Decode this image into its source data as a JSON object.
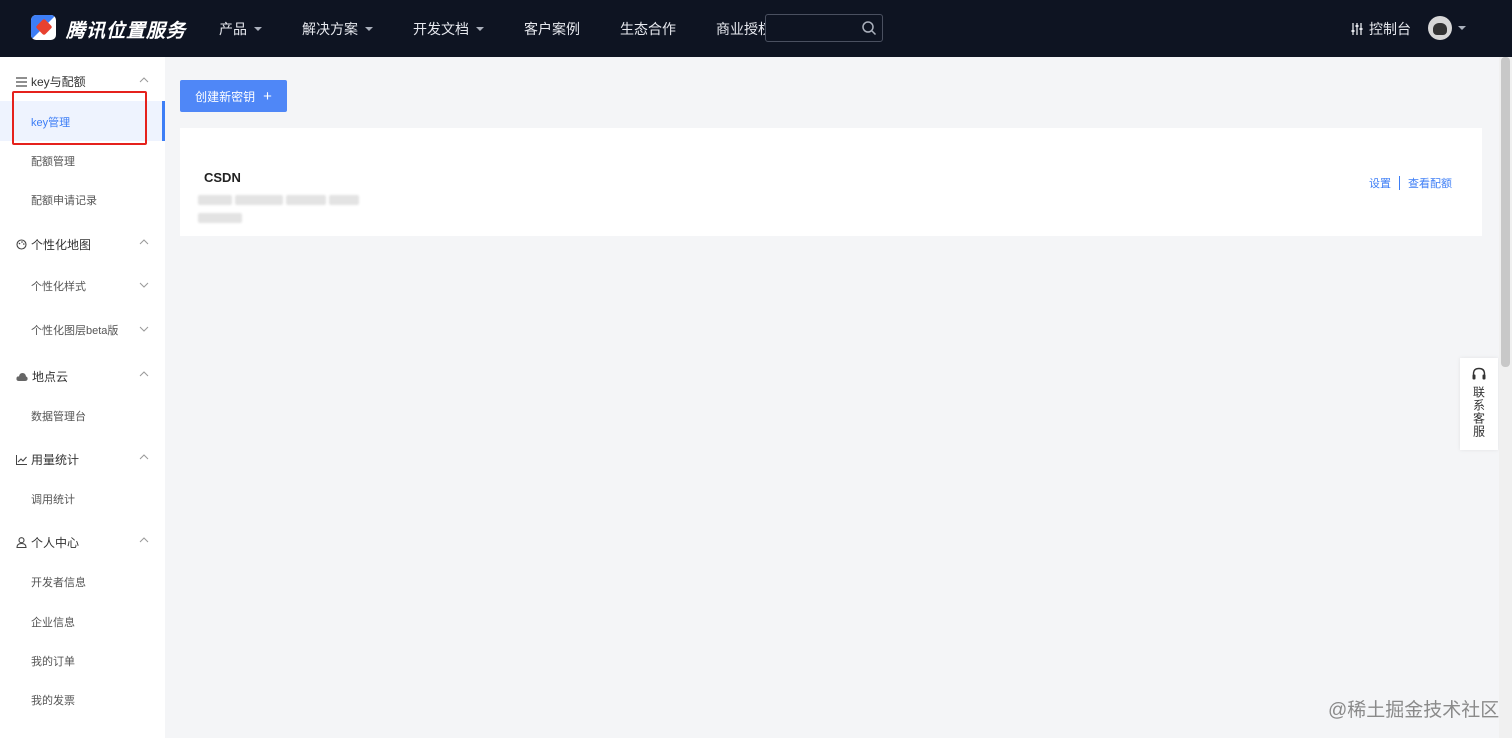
{
  "header": {
    "brand": "腾讯位置服务",
    "nav": [
      {
        "label": "产品",
        "dropdown": true
      },
      {
        "label": "解决方案",
        "dropdown": true
      },
      {
        "label": "开发文档",
        "dropdown": true
      },
      {
        "label": "客户案例",
        "dropdown": false
      },
      {
        "label": "生态合作",
        "dropdown": false
      },
      {
        "label": "商业授权",
        "dropdown": false
      }
    ],
    "search_placeholder": "",
    "console_label": "控制台"
  },
  "sidebar": {
    "groups": [
      {
        "label": "key与配额",
        "icon": "list-icon",
        "items": [
          {
            "label": "key管理",
            "active": true
          },
          {
            "label": "配额管理"
          },
          {
            "label": "配额申请记录"
          }
        ]
      },
      {
        "label": "个性化地图",
        "icon": "palette-icon",
        "items": [
          {
            "label": "个性化样式"
          },
          {
            "label": "个性化图层beta版"
          }
        ]
      },
      {
        "label": "地点云",
        "icon": "cloud-icon",
        "items": [
          {
            "label": "数据管理台"
          }
        ]
      },
      {
        "label": "用量统计",
        "icon": "chart-icon",
        "items": [
          {
            "label": "调用统计"
          }
        ]
      },
      {
        "label": "个人中心",
        "icon": "user-icon",
        "items": [
          {
            "label": "开发者信息"
          },
          {
            "label": "企业信息"
          },
          {
            "label": "我的订单"
          },
          {
            "label": "我的发票"
          }
        ]
      }
    ]
  },
  "main": {
    "create_button": "创建新密钥",
    "card": {
      "name": "CSDN",
      "actions": [
        "设置",
        "查看配额"
      ]
    }
  },
  "service_label": "联系客服",
  "watermark": "@稀土掘金技术社区",
  "colors": {
    "accent": "#3d7ef6",
    "topbar": "#0e1422",
    "highlight": "#e5211c"
  }
}
